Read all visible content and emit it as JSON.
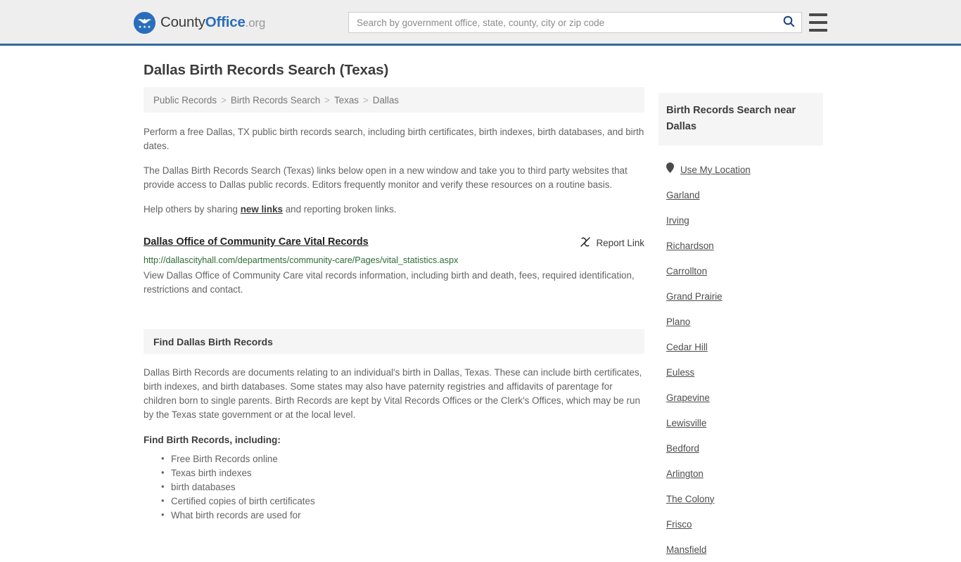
{
  "header": {
    "brand": {
      "logo_icon": "eagle-stars-seal-icon",
      "text_part1": "County",
      "text_part2": "Office",
      "text_part3": ".org",
      "brand_color": "#2a6ebb"
    },
    "search": {
      "placeholder": "Search by government office, state, county, city or zip code",
      "value": "",
      "icon": "search-icon"
    },
    "menu": {
      "icon": "hamburger-menu-icon",
      "label": "Menu"
    },
    "background_color": "#eeeeee",
    "accent_border_color": "#33699c"
  },
  "page": {
    "title": "Dallas Birth Records Search (Texas)"
  },
  "breadcrumb": {
    "items": [
      {
        "label": "Public Records"
      },
      {
        "label": "Birth Records Search"
      },
      {
        "label": "Texas"
      },
      {
        "label": "Dallas"
      }
    ],
    "separator": ">"
  },
  "intro": {
    "paragraphs": [
      "Perform a free Dallas, TX public birth records search, including birth certificates, birth indexes, birth databases, and birth dates.",
      "The Dallas Birth Records Search (Texas) links below open in a new window and take you to third party websites that provide access to Dallas public records. Editors frequently monitor and verify these resources on a routine basis."
    ],
    "help_prefix": "Help others by sharing ",
    "help_link": "new links",
    "help_suffix": " and reporting broken links."
  },
  "result": {
    "title": "Dallas Office of Community Care Vital Records",
    "url": "http://dallascityhall.com/departments/community-care/Pages/vital_statistics.aspx",
    "url_color": "#2b6d36",
    "description": "View Dallas Office of Community Care vital records information, including birth and death, fees, required identification, restrictions and contact.",
    "report": {
      "label": "Report Link",
      "icon": "broken-link-icon"
    }
  },
  "section": {
    "heading": "Find Dallas Birth Records",
    "body": "Dallas Birth Records are documents relating to an individual's birth in Dallas, Texas. These can include birth certificates, birth indexes, and birth databases. Some states may also have paternity registries and affidavits of parentage for children born to single parents. Birth Records are kept by Vital Records Offices or the Clerk's Offices, which may be run by the Texas state government or at the local level.",
    "list_label": "Find Birth Records, including:",
    "list_items": [
      "Free Birth Records online",
      "Texas birth indexes",
      "birth databases",
      "Certified copies of birth certificates",
      "What birth records are used for"
    ]
  },
  "sidebar": {
    "heading": "Birth Records Search near Dallas",
    "use_my_location": {
      "label": "Use My Location",
      "icon": "map-pin-icon"
    },
    "cities": [
      {
        "label": "Garland"
      },
      {
        "label": "Irving"
      },
      {
        "label": "Richardson"
      },
      {
        "label": "Carrollton"
      },
      {
        "label": "Grand Prairie"
      },
      {
        "label": "Plano"
      },
      {
        "label": "Cedar Hill"
      },
      {
        "label": "Euless"
      },
      {
        "label": "Grapevine"
      },
      {
        "label": "Lewisville"
      },
      {
        "label": "Bedford"
      },
      {
        "label": "Arlington"
      },
      {
        "label": "The Colony"
      },
      {
        "label": "Frisco"
      },
      {
        "label": "Mansfield"
      }
    ]
  }
}
